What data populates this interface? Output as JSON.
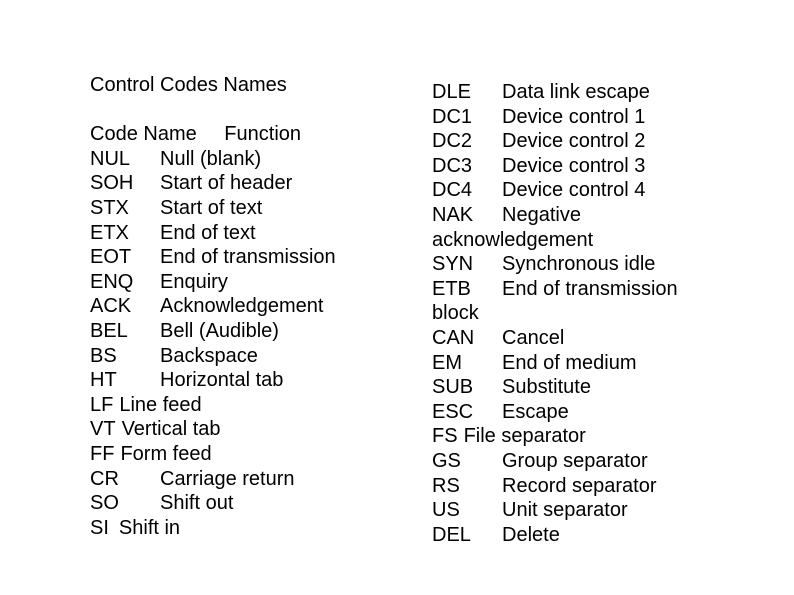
{
  "title": "Control Codes Names",
  "header": {
    "code": "Code",
    "name": "Name",
    "function": "Function"
  },
  "left_rows": [
    {
      "code": "NUL",
      "function": "Null (blank)"
    },
    {
      "code": "SOH",
      "function": "Start of header"
    },
    {
      "code": "STX",
      "function": "Start of text"
    },
    {
      "code": "ETX",
      "function": "End of text"
    },
    {
      "code": "EOT",
      "function": "End of transmission"
    },
    {
      "code": "ENQ",
      "function": "Enquiry"
    },
    {
      "code": "ACK",
      "function": "Acknowledgement"
    },
    {
      "code": "BEL",
      "function": "Bell (Audible)"
    },
    {
      "code": "BS",
      "function": "Backspace"
    },
    {
      "code": "HT",
      "function": "Horizontal tab"
    },
    {
      "code": "LF",
      "function": "Line feed"
    },
    {
      "code": "VT",
      "function": "Vertical tab"
    },
    {
      "code": "FF",
      "function": "Form feed"
    },
    {
      "code": "CR",
      "function": "Carriage return"
    },
    {
      "code": "SO",
      "function": "Shift out"
    },
    {
      "code": "SI",
      "function": "Shift in"
    }
  ],
  "right_rows": [
    {
      "code": "DLE",
      "function": "Data link escape"
    },
    {
      "code": "DC1",
      "function": "Device control 1"
    },
    {
      "code": "DC2",
      "function": "Device control 2"
    },
    {
      "code": "DC3",
      "function": "Device control 3"
    },
    {
      "code": "DC4",
      "function": "Device control 4"
    },
    {
      "code": "NAK",
      "function": "Negative",
      "continuation": "acknowledgement"
    },
    {
      "code": "SYN",
      "function": "Synchronous idle"
    },
    {
      "code": "ETB",
      "function": "End of transmission",
      "continuation": "block"
    },
    {
      "code": "CAN",
      "function": "Cancel"
    },
    {
      "code": "EM",
      "function": "End of medium"
    },
    {
      "code": "SUB",
      "function": "Substitute"
    },
    {
      "code": "ESC",
      "function": "Escape"
    },
    {
      "code": "FS",
      "function": "File separator"
    },
    {
      "code": "GS",
      "function": "Group separator"
    },
    {
      "code": "RS",
      "function": "Record separator"
    },
    {
      "code": "US",
      "function": "Unit separator"
    },
    {
      "code": "DEL",
      "function": "Delete"
    }
  ]
}
